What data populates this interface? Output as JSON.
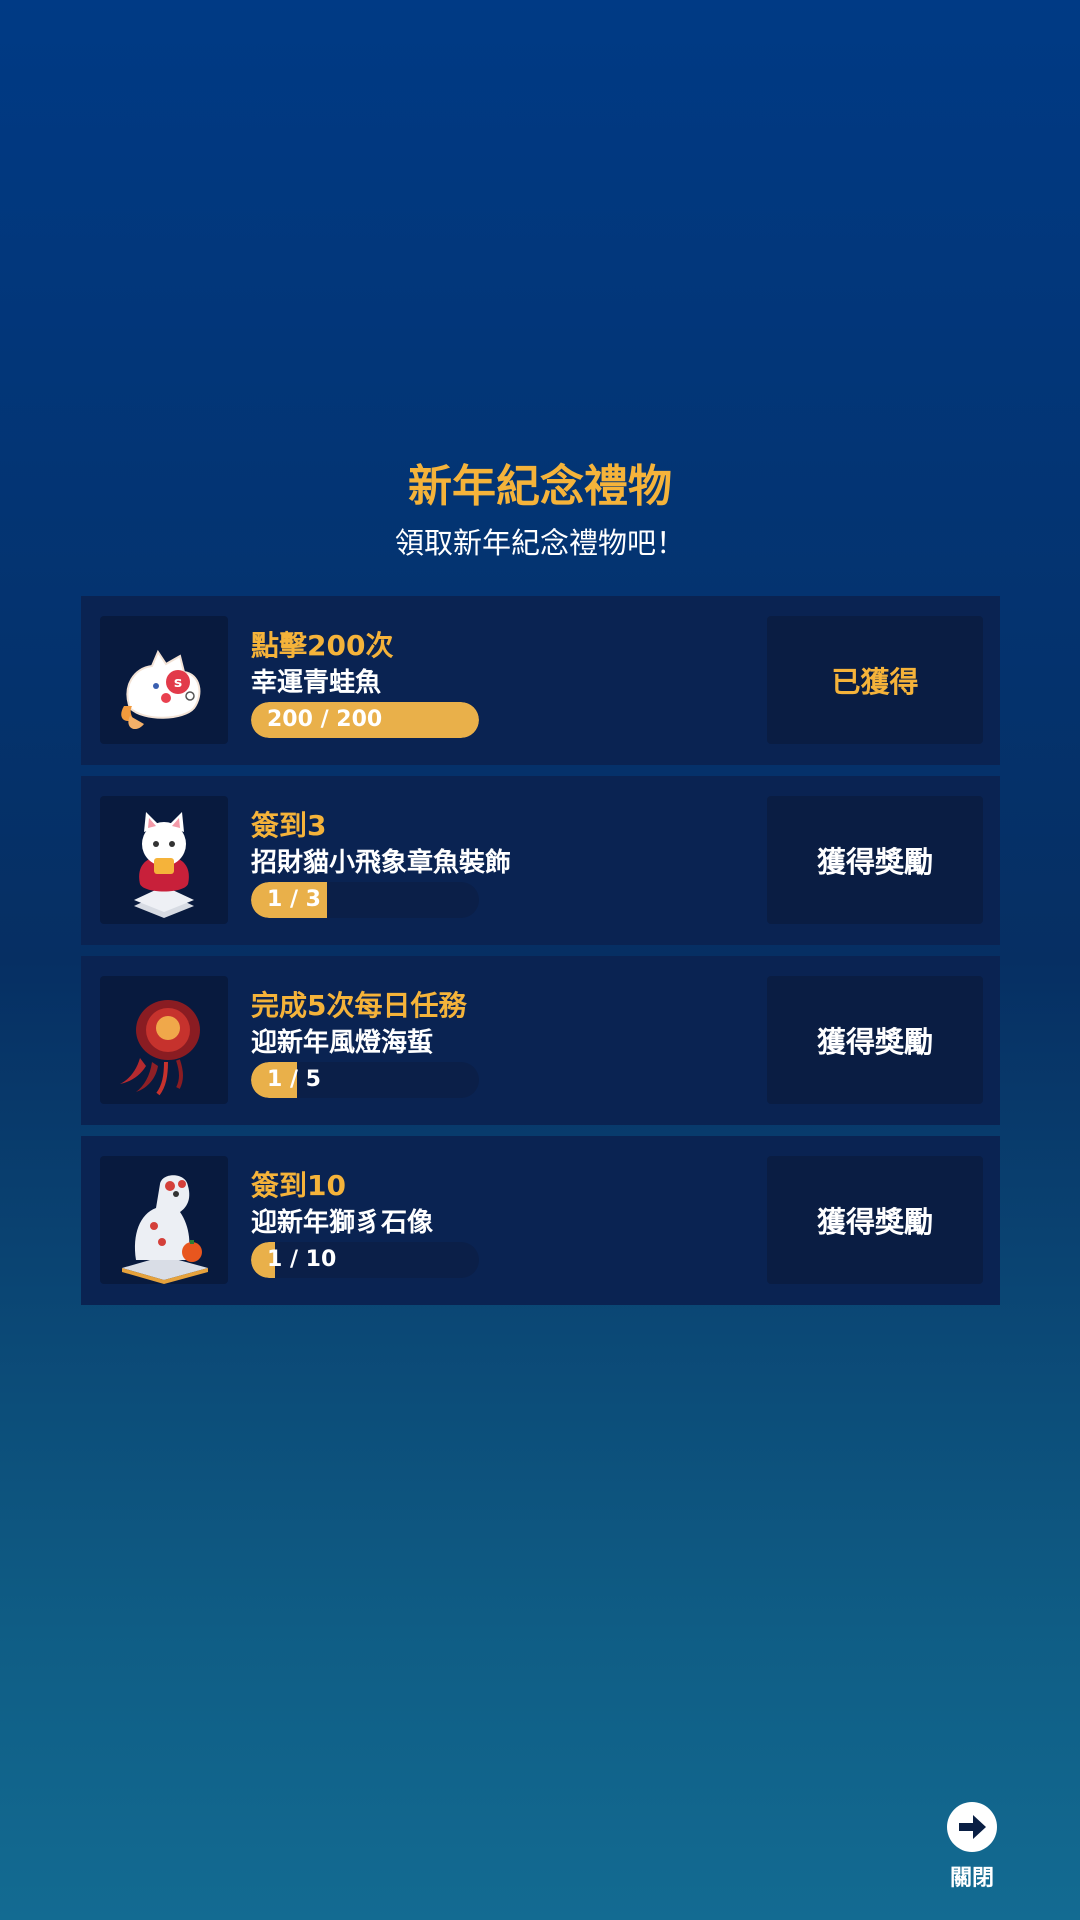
{
  "header": {
    "title": "新年紀念禮物",
    "subtitle": "領取新年紀念禮物吧！"
  },
  "items": [
    {
      "task": "點擊200次",
      "reward": "幸運青蛙魚",
      "progress_text": "200 / 200",
      "progress": 1.0,
      "button": "已獲得",
      "icon": "lucky-frog-fish-icon"
    },
    {
      "task": "簽到3",
      "reward": "招財貓小飛象章魚裝飾",
      "progress_text": "1 / 3",
      "progress": 0.333,
      "button": "獲得獎勵",
      "icon": "lucky-cat-octopus-icon"
    },
    {
      "task": "完成5次每日任務",
      "reward": "迎新年風燈海蜇",
      "progress_text": "1 / 5",
      "progress": 0.2,
      "button": "獲得獎勵",
      "icon": "lantern-jellyfish-icon"
    },
    {
      "task": "簽到10",
      "reward": "迎新年獅豸石像",
      "progress_text": "1 / 10",
      "progress": 0.1,
      "button": "獲得獎勵",
      "icon": "lion-statue-icon"
    }
  ],
  "close": {
    "label": "關閉",
    "icon": "arrow-right-circle-icon"
  },
  "colors": {
    "accent": "#f5b33a",
    "card_bg": "#0a2352",
    "progress_fill": "#e9b04a"
  }
}
